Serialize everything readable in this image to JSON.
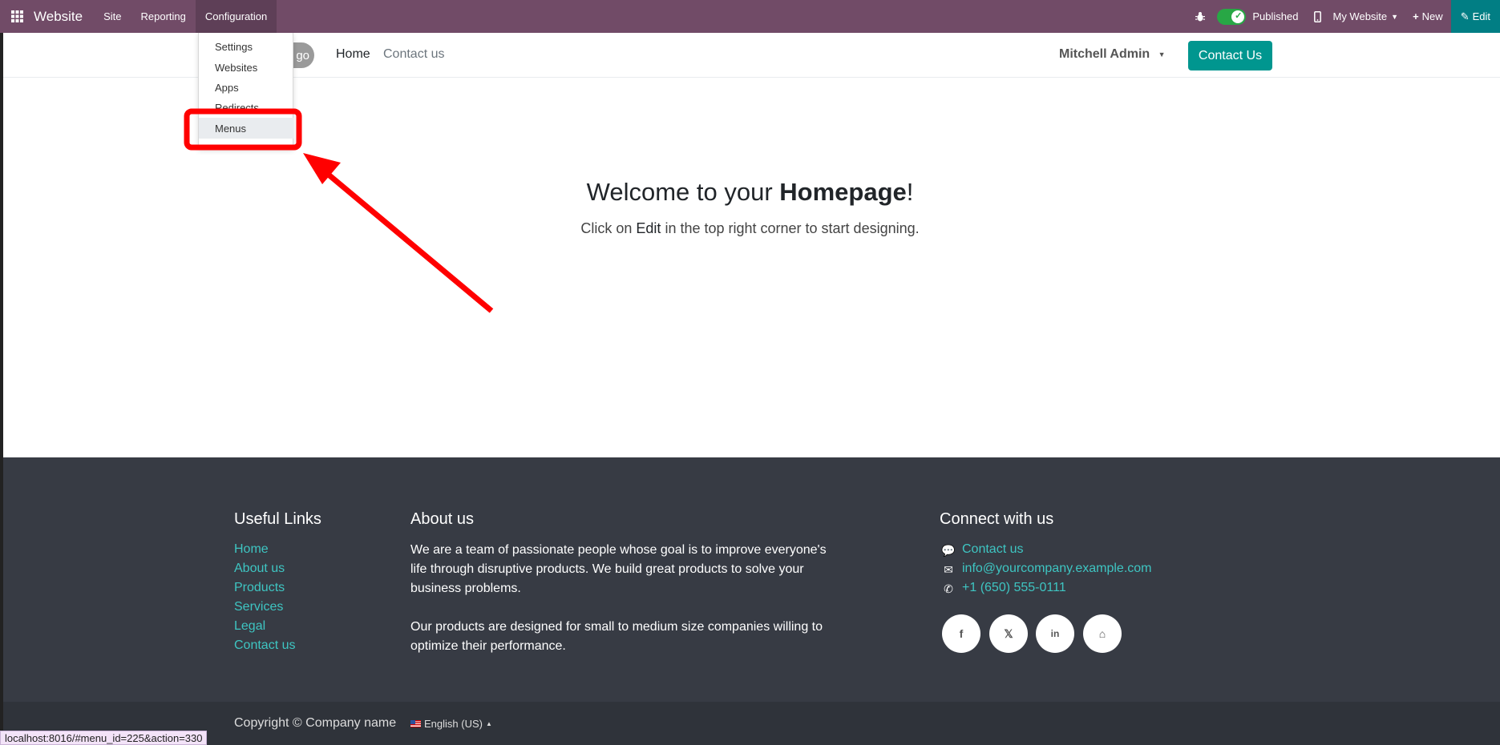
{
  "topbar": {
    "brand": "Website",
    "menu": [
      "Site",
      "Reporting",
      "Configuration"
    ],
    "published_label": "Published",
    "website_selector": "My Website",
    "new_label": "New",
    "edit_label": "Edit",
    "colors": {
      "bar": "#714b67",
      "edit": "#017e84",
      "toggle": "#28a745"
    }
  },
  "dropdown": {
    "items": [
      "Settings",
      "Websites",
      "Apps",
      "Redirects",
      "Menus"
    ],
    "highlighted": "Menus"
  },
  "site_header": {
    "logo_text": "go",
    "nav": [
      "Home",
      "Contact us"
    ],
    "user": "Mitchell Admin",
    "cta": "Contact Us"
  },
  "hero": {
    "title_prefix": "Welcome to your ",
    "title_bold": "Homepage",
    "title_suffix": "!",
    "sub_prefix": "Click on ",
    "sub_bold": "Edit",
    "sub_suffix": " in the top right corner to start designing."
  },
  "footer": {
    "useful_links": {
      "heading": "Useful Links",
      "links": [
        "Home",
        "About us",
        "Products",
        "Services",
        "Legal",
        "Contact us"
      ]
    },
    "about": {
      "heading": "About us",
      "para1": [
        "We are a team of passionate people whose goal is to improve everyone's",
        "life through disruptive products. We build great products to solve your",
        "business problems."
      ],
      "para2": [
        "Our products are designed for small to medium size companies willing to",
        "optimize their performance."
      ]
    },
    "connect": {
      "heading": "Connect with us",
      "contact": "Contact us",
      "email": "info@yourcompany.example.com",
      "phone": "+1 (650) 555-0111"
    },
    "copyright": "Copyright © Company name",
    "language": "English (US)"
  },
  "statusbar": "localhost:8016/#menu_id=225&action=330"
}
